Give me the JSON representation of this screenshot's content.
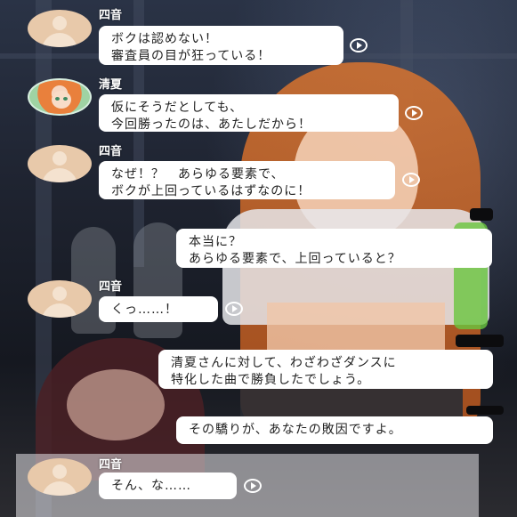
{
  "messages": [
    {
      "speaker": "四音",
      "text": "ボクは認めない！\n審査員の目が狂っている！",
      "avatar": "placeholder-avatar-icon",
      "side": "left",
      "voice": true
    },
    {
      "speaker": "清夏",
      "text": "仮にそうだとしても、\n今回勝ったのは、あたしだから！",
      "avatar": "character-portrait",
      "side": "left",
      "voice": true
    },
    {
      "speaker": "四音",
      "text": "なぜ！？　あらゆる要素で、\nボクが上回っているはずなのに！",
      "avatar": "placeholder-avatar-icon",
      "side": "left",
      "voice": true
    },
    {
      "speaker": "",
      "text": "本当に？\nあらゆる要素で、上回っていると？",
      "side": "right",
      "voice": false
    },
    {
      "speaker": "四音",
      "text": "くっ……！",
      "avatar": "placeholder-avatar-icon",
      "side": "left",
      "voice": true
    },
    {
      "speaker": "",
      "text": "清夏さんに対して、わざわざダンスに\n特化した曲で勝負したでしょう。",
      "side": "right",
      "voice": false
    },
    {
      "speaker": "",
      "text": "その驕りが、あなたの敗因ですよ。",
      "side": "right",
      "voice": false
    },
    {
      "speaker": "四音",
      "text": "そん、な……",
      "avatar": "placeholder-avatar-icon",
      "side": "left",
      "voice": true
    }
  ],
  "colors": {
    "bubble": "#ffffff",
    "name_text": "#ffffff",
    "avatar_placeholder": "#e8c9aa"
  },
  "icons": {
    "voice_play": "play-circle-icon"
  }
}
